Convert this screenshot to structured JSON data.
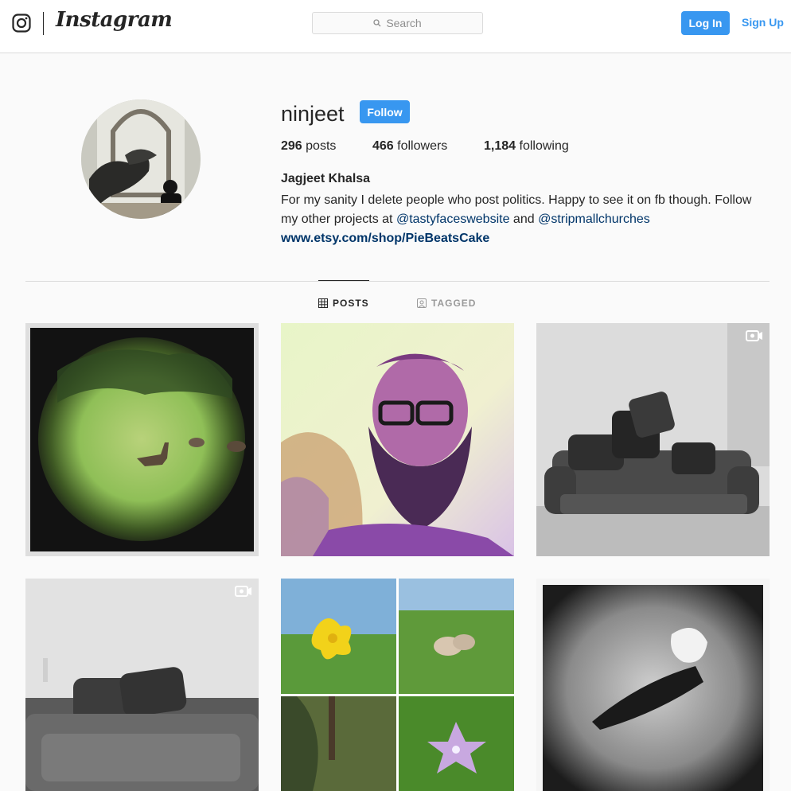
{
  "header": {
    "logo_text": "Instagram",
    "search_placeholder": "Search",
    "login_label": "Log In",
    "signup_label": "Sign Up"
  },
  "profile": {
    "username": "ninjeet",
    "follow_label": "Follow",
    "posts_count": "296",
    "posts_label": "posts",
    "followers_count": "466",
    "followers_label": "followers",
    "following_count": "1,184",
    "following_label": "following",
    "full_name": "Jagjeet Khalsa",
    "bio_line1": "For my sanity I delete people who post politics. Happy to see it on fb though. Follow",
    "bio_line2_prefix": "my other projects at ",
    "mention1": "@tastyfaceswebsite",
    "bio_and": " and ",
    "mention2": "@stripmallchurches",
    "website": "www.etsy.com/shop/PieBeatsCake"
  },
  "tabs": [
    {
      "label": "POSTS",
      "active": true
    },
    {
      "label": "TAGGED",
      "active": false
    }
  ],
  "posts": [
    {
      "subject": "deer in meadow",
      "video": false
    },
    {
      "subject": "bearded man selfie",
      "video": false
    },
    {
      "subject": "couch with pillows",
      "video": true
    },
    {
      "subject": "couch with pillows close-up",
      "video": true
    },
    {
      "subject": "flowers collage",
      "video": false
    },
    {
      "subject": "pie slice on textured surface",
      "video": false
    }
  ],
  "colors": {
    "accent": "#3897f0",
    "link": "#003569",
    "text": "#262626",
    "border": "#dbdbdb",
    "background": "#fafafa"
  }
}
